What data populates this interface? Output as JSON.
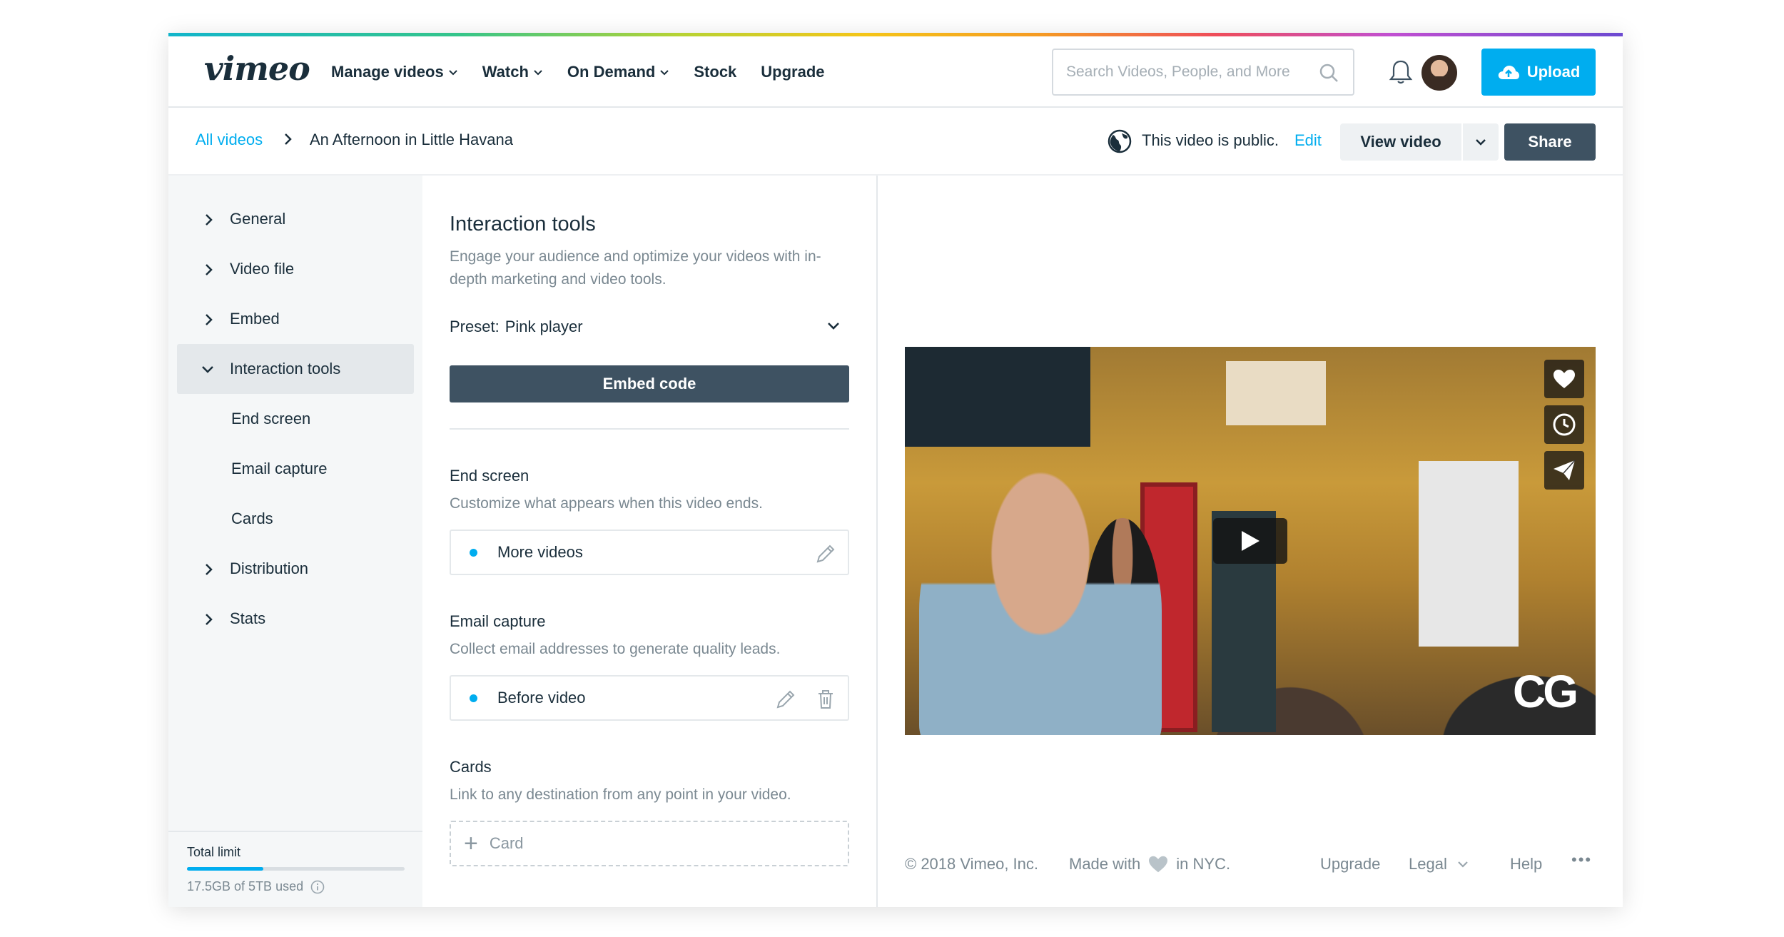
{
  "brand": {
    "logo_text": "vimeo",
    "accent": "#00adef",
    "dark_button": "#3e5262"
  },
  "nav": {
    "items": [
      {
        "label": "Manage videos",
        "has_dropdown": true
      },
      {
        "label": "Watch",
        "has_dropdown": true
      },
      {
        "label": "On Demand",
        "has_dropdown": true
      },
      {
        "label": "Stock",
        "has_dropdown": false
      },
      {
        "label": "Upgrade",
        "has_dropdown": false
      }
    ],
    "search_placeholder": "Search Videos, People, and More",
    "upload_label": "Upload"
  },
  "subbar": {
    "breadcrumb_link": "All videos",
    "video_title": "An Afternoon in Little Havana",
    "privacy_text": "This video is public.",
    "privacy_edit": "Edit",
    "view_video_label": "View video",
    "share_label": "Share"
  },
  "sidebar": {
    "items": [
      {
        "label": "General",
        "type": "top",
        "expanded": false
      },
      {
        "label": "Video file",
        "type": "top",
        "expanded": false
      },
      {
        "label": "Embed",
        "type": "top",
        "expanded": false
      },
      {
        "label": "Interaction tools",
        "type": "top",
        "expanded": true,
        "active": true
      },
      {
        "label": "End screen",
        "type": "sub"
      },
      {
        "label": "Email capture",
        "type": "sub"
      },
      {
        "label": "Cards",
        "type": "sub"
      },
      {
        "label": "Distribution",
        "type": "top",
        "expanded": false
      },
      {
        "label": "Stats",
        "type": "top",
        "expanded": false
      }
    ],
    "limit_label": "Total limit",
    "limit_used_text": "17.5GB of 5TB used",
    "limit_fraction": 0.35
  },
  "panel": {
    "title": "Interaction tools",
    "description": "Engage your audience and optimize your videos with in-depth marketing and video tools.",
    "preset_label": "Preset:",
    "preset_value": "Pink player",
    "embed_label": "Embed code",
    "end_screen": {
      "title": "End screen",
      "description": "Customize what appears when this video ends.",
      "option": "More videos"
    },
    "email_capture": {
      "title": "Email capture",
      "description": "Collect email addresses to generate quality leads.",
      "option": "Before video"
    },
    "cards": {
      "title": "Cards",
      "description": "Link to any destination from any point in your video.",
      "add_label": "Card"
    }
  },
  "video": {
    "watermark": "CG"
  },
  "footer": {
    "copyright": "© 2018 Vimeo, Inc.",
    "made_with": "Made with",
    "in_nyc": "in NYC.",
    "upgrade": "Upgrade",
    "legal": "Legal",
    "help": "Help",
    "more": "•••"
  }
}
